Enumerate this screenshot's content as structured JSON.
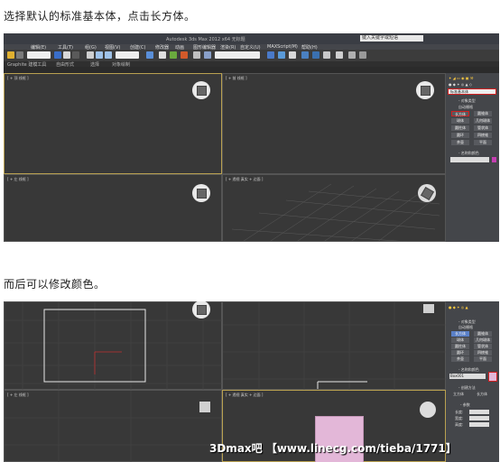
{
  "caption1": "选择默认的标准基本体，点击长方体。",
  "caption2": "而后可以修改颜色。",
  "max_title": "Autodesk 3ds Max 2012 x64    无标题",
  "search_placeholder": "键入关键字或短语",
  "menu_items": [
    "编辑(E)",
    "工具(T)",
    "组(G)",
    "视图(V)",
    "创建(C)",
    "修改器",
    "动画",
    "图形编辑器",
    "渲染(R)",
    "自定义(U)",
    "MAXScript(M)",
    "帮助(H)"
  ],
  "ribbon_items": [
    "Graphite 建模工具",
    "自由形式",
    "选择",
    "对象绘制"
  ],
  "viewport_labels": {
    "top": "[ + 顶 线框 ]",
    "front": "[ + 前 线框 ]",
    "left": "[ + 左 线框 ]",
    "persp": "[ + 透视 真实 + 边面 ]"
  },
  "panel": {
    "dropdown": "标准基本体",
    "object_type": "- 对象类型",
    "autogrid": "自动栅格",
    "buttons": [
      "长方体",
      "圆锥体",
      "球体",
      "几何球体",
      "圆柱体",
      "管状体",
      "圆环",
      "四棱锥",
      "茶壶",
      "平面"
    ],
    "name_color": "- 名称和颜色",
    "name_value": "Box001",
    "create_method": "- 创建方法",
    "cube": "立方体",
    "box": "长方体",
    "params": "- 参数",
    "length": "长度:",
    "width": "宽度:",
    "height": "高度:"
  },
  "watermark": "3Dmax吧 【www.linecg.com/tieba/1771】",
  "colors": {
    "highlight": "#d12020",
    "box_pink": "#e3b7d8",
    "viewport_bg": "#383838",
    "color_swatch": "#c43fb1"
  }
}
